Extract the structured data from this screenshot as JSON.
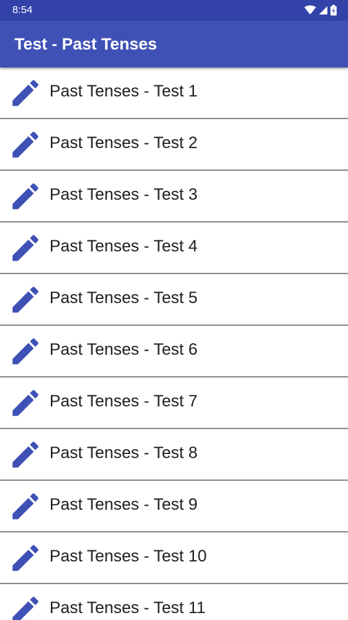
{
  "status_bar": {
    "time": "8:54",
    "icons": [
      "wifi-icon",
      "signal-icon",
      "battery-icon"
    ]
  },
  "app_bar": {
    "title": "Test - Past Tenses"
  },
  "theme": {
    "status_bar_color": "#3242a8",
    "app_bar_color": "#3f51b5",
    "icon_color": "#3f51b5",
    "text_color": "#1f1f1f"
  },
  "list": {
    "item_icon": "pencil-icon",
    "items": [
      {
        "label": "Past Tenses - Test 1"
      },
      {
        "label": "Past Tenses - Test 2"
      },
      {
        "label": "Past Tenses - Test 3"
      },
      {
        "label": "Past Tenses - Test 4"
      },
      {
        "label": "Past Tenses - Test 5"
      },
      {
        "label": "Past Tenses - Test 6"
      },
      {
        "label": "Past Tenses - Test 7"
      },
      {
        "label": "Past Tenses - Test 8"
      },
      {
        "label": "Past Tenses - Test 9"
      },
      {
        "label": "Past Tenses - Test 10"
      },
      {
        "label": "Past Tenses - Test 11"
      }
    ]
  }
}
